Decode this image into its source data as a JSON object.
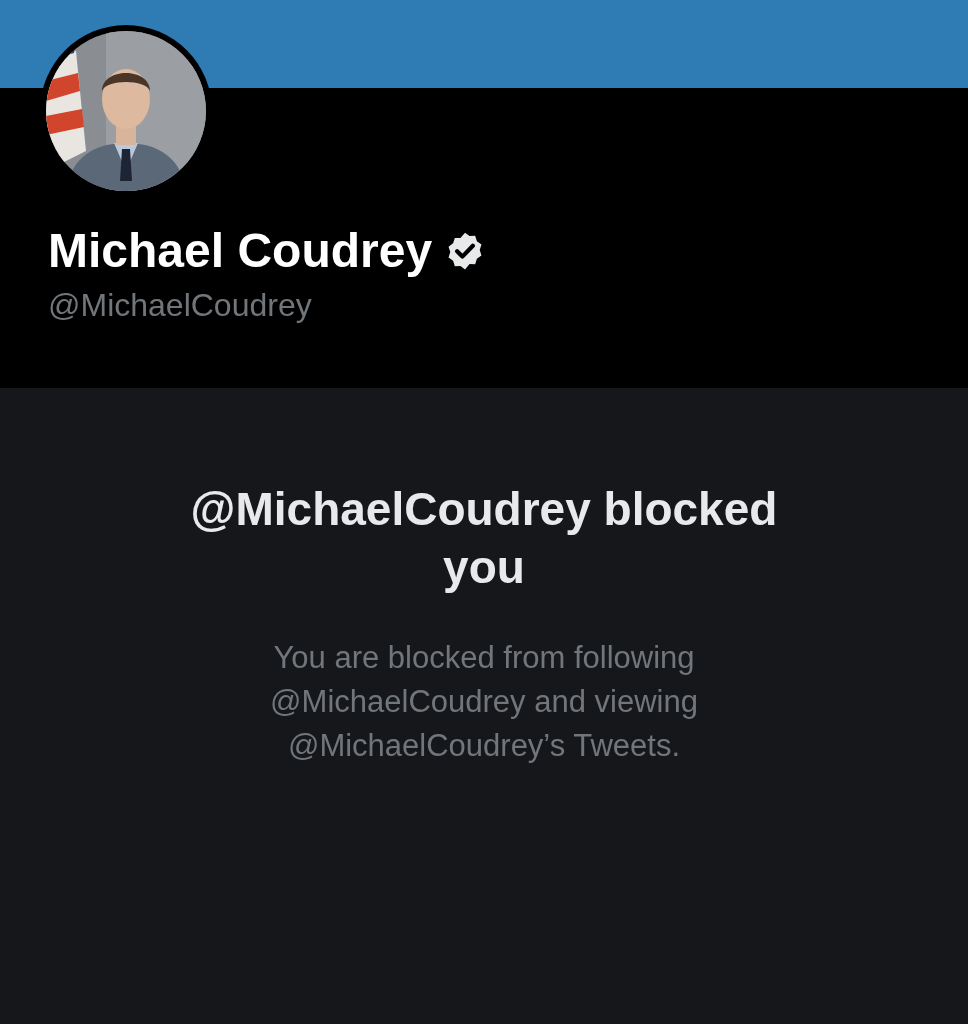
{
  "profile": {
    "name": "Michael Coudrey",
    "verified": true,
    "handle": "@MichaelCoudrey"
  },
  "blocked_notice": {
    "title": "@MichaelCoudrey blocked you",
    "message": "You are blocked from following @MichaelCoudrey and viewing @MichaelCoudrey’s Tweets."
  }
}
